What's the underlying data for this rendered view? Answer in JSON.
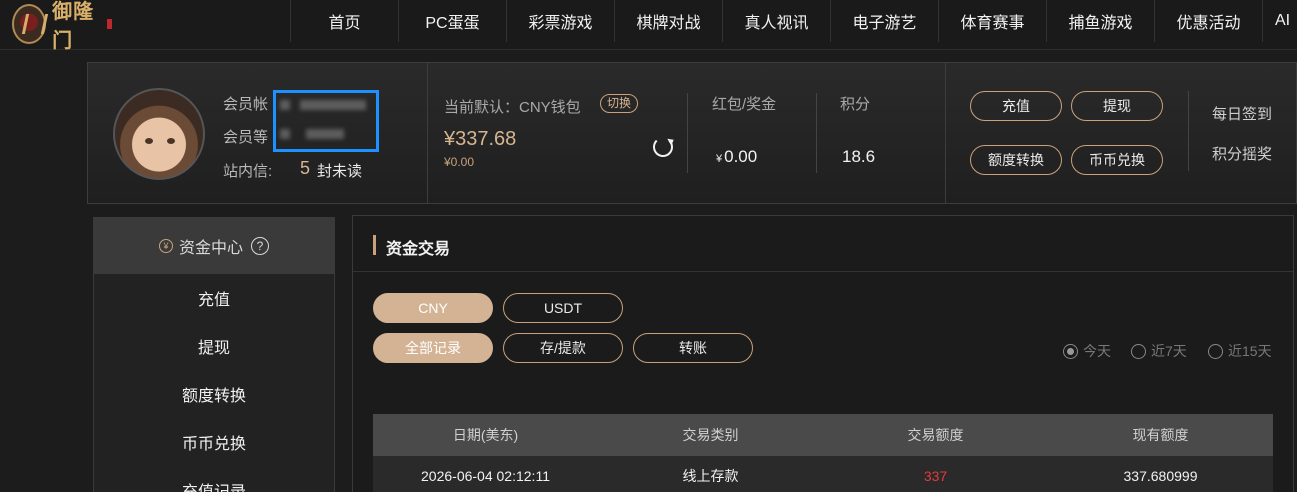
{
  "brand": {
    "name": "御隆门"
  },
  "nav": {
    "items": [
      "首页",
      "PC蛋蛋",
      "彩票游戏",
      "棋牌对战",
      "真人视讯",
      "电子游艺",
      "体育赛事",
      "捕鱼游戏",
      "优惠活动",
      "AI"
    ]
  },
  "account": {
    "label_account": "会员帐",
    "label_level": "会员等",
    "label_messages": "站内信:",
    "message_count": "5",
    "message_unread": "封未读",
    "wallet_label": "当前默认：CNY钱包",
    "switch_label": "切换",
    "balance": "¥337.68",
    "balance_sub": "¥0.00",
    "redpacket_label": "红包/奖金",
    "redpacket_currency": "¥",
    "redpacket_value": "0.00",
    "points_label": "积分",
    "points_value": "18.6",
    "actions": {
      "deposit": "充值",
      "withdraw": "提现",
      "transfer": "额度转换",
      "exchange": "币币兑换"
    },
    "links": {
      "checkin": "每日签到",
      "lottery": "积分摇奖"
    }
  },
  "sidebar": {
    "title": "资金中心",
    "items": [
      "充值",
      "提现",
      "额度转换",
      "币币兑换",
      "充值记录"
    ]
  },
  "main": {
    "title": "资金交易",
    "currency_tabs": [
      "CNY",
      "USDT"
    ],
    "type_tabs": [
      "全部记录",
      "存/提款",
      "转账"
    ],
    "range_options": [
      "今天",
      "近7天",
      "近15天"
    ],
    "table": {
      "headers": [
        "日期(美东)",
        "交易类别",
        "交易额度",
        "现有额度"
      ],
      "rows": [
        [
          "2026-06-04 02:12:11",
          "线上存款",
          "337",
          "337.680999"
        ]
      ]
    }
  },
  "colors": {
    "accent": "#c9a27c",
    "active_tab": "#d3b394",
    "highlight_blue": "#1e90ff",
    "amount_red": "#e23b3b"
  }
}
